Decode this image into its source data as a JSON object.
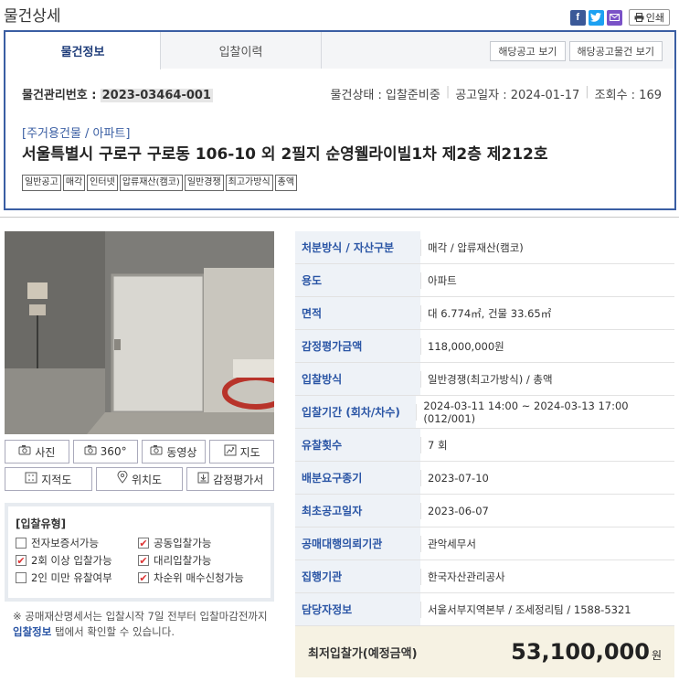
{
  "page": {
    "title": "물건상세"
  },
  "share": {
    "facebook_glyph": "f",
    "print_label": "인쇄"
  },
  "tabs": [
    {
      "label": "물건정보",
      "active": true
    },
    {
      "label": "입찰이력",
      "active": false
    }
  ],
  "tab_buttons": {
    "notice_view": "해당공고 보기",
    "notice_items_view": "해당공고물건 보기"
  },
  "item": {
    "mgmt_label": "물건관리번호 :",
    "mgmt_number": "2023-03464-001",
    "status": "물건상태 : 입찰준비중",
    "notice_date": "공고일자 : 2024-01-17",
    "views": "조회수 : 169",
    "category": "[주거용건물 / 아파트]",
    "address": "서울특별시 구로구 구로동 106-10 외 2필지 순영웰라이빌1차 제2층 제212호",
    "tags": [
      "일반공고",
      "매각",
      "인터넷",
      "압류재산(캠코)",
      "일반경쟁",
      "최고가방식",
      "총액"
    ]
  },
  "media_buttons": {
    "row1": [
      {
        "icon": "camera-icon",
        "label": "사진"
      },
      {
        "icon": "camera-360-icon",
        "label": "360°"
      },
      {
        "icon": "video-icon",
        "label": "동영상"
      },
      {
        "icon": "map-icon",
        "label": "지도"
      }
    ],
    "row2": [
      {
        "icon": "cadastral-map-icon",
        "label": "지적도"
      },
      {
        "icon": "location-pin-icon",
        "label": "위치도"
      },
      {
        "icon": "download-icon",
        "label": "감정평가서"
      }
    ]
  },
  "bid_type": {
    "title": "[입찰유형]",
    "options": [
      {
        "label": "전자보증서가능",
        "checked": false
      },
      {
        "label": "공동입찰가능",
        "checked": true
      },
      {
        "label": "2회 이상 입찰가능",
        "checked": true
      },
      {
        "label": "대리입찰가능",
        "checked": true
      },
      {
        "label": "2인 미만 유찰여부",
        "checked": false
      },
      {
        "label": "차순위 매수신청가능",
        "checked": true
      }
    ]
  },
  "note": {
    "part1": "※ 공매재산명세서는 입찰시작 7일 전부터 입찰마감전까지 ",
    "link": "입찰정보",
    "part2": " 탭에서 확인할 수 있습니다."
  },
  "details": [
    {
      "label": "처분방식 / 자산구분",
      "value": "매각 / 압류재산(캠코)"
    },
    {
      "label": "용도",
      "value": "아파트"
    },
    {
      "label": "면적",
      "value": "대 6.774㎡, 건물 33.65㎡"
    },
    {
      "label": "감정평가금액",
      "value": "118,000,000원"
    },
    {
      "label": "입찰방식",
      "value": "일반경쟁(최고가방식) / 총액"
    },
    {
      "label": "입찰기간 (회차/차수)",
      "value": "2024-03-11 14:00 ~ 2024-03-13 17:00 (012/001)"
    },
    {
      "label": "유찰횟수",
      "value": "7 회"
    },
    {
      "label": "배분요구종기",
      "value": "2023-07-10"
    },
    {
      "label": "최초공고일자",
      "value": "2023-06-07"
    },
    {
      "label": "공매대행의뢰기관",
      "value": "관악세무서"
    },
    {
      "label": "집행기관",
      "value": "한국자산관리공사"
    },
    {
      "label": "담당자정보",
      "value": "서울서부지역본부 / 조세정리팀 / 1588-5321"
    }
  ],
  "lowest_bid": {
    "label": "최저입찰가(예정금액)",
    "amount": "53,100,000",
    "unit": "원"
  }
}
